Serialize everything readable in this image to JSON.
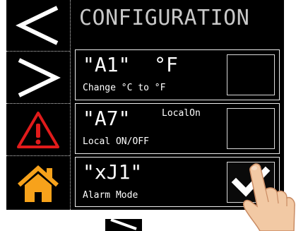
{
  "header": {
    "title": "CONFIGURATION"
  },
  "sidebar": {
    "items": [
      {
        "icon": "chevron-left-icon"
      },
      {
        "icon": "chevron-right-icon"
      },
      {
        "icon": "warning-icon",
        "color": "#e01b1b"
      },
      {
        "icon": "home-icon",
        "color": "#f7a21b"
      }
    ]
  },
  "params": [
    {
      "code": "\"A1\"  °F",
      "description": "Change °C to °F",
      "value": "",
      "checked": false
    },
    {
      "code": "\"A7\"",
      "description": "Local ON/OFF",
      "value": "LocalOn",
      "checked": false
    },
    {
      "code": "\"xJ1\"",
      "description": "Alarm Mode",
      "value": "",
      "checked": true
    }
  ],
  "footer": {
    "icon": "chevron-right-icon"
  }
}
